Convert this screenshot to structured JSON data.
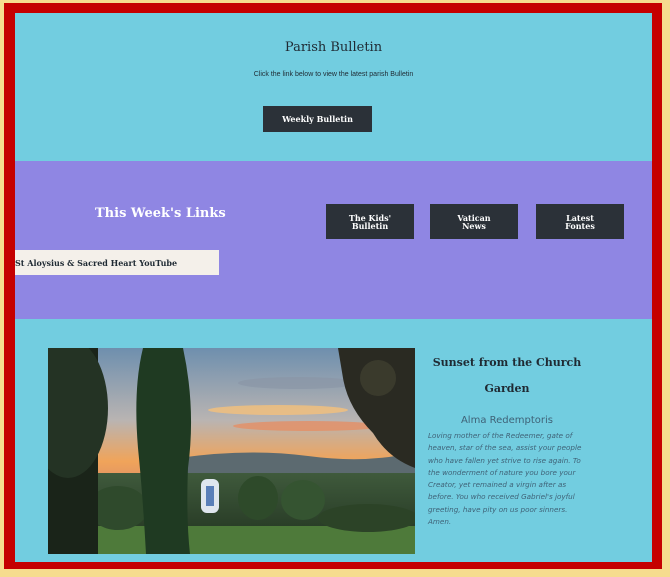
{
  "bulletin": {
    "title": "Parish Bulletin",
    "subtitle": "Click the link below to view the latest parish Bulletin",
    "button_label": "Weekly Bulletin"
  },
  "links": {
    "title": "This Week's Links",
    "kids_label": "The Kids' Bulletin",
    "vatican_label": "Vatican News",
    "fontes_label": "Latest Fontes",
    "youtube_label": "St Aloysius & Sacred Heart YouTube"
  },
  "garden": {
    "photo_title": "Sunset from the Church Garden",
    "prayer_title": "Alma Redemptoris",
    "prayer_text": "Loving mother of the Redeemer, gate of heaven, star of the sea, assist your people who have fallen yet strive to rise again. To the wonderment of nature you bore your Creator, yet remained a virgin after as before. You who received Gabriel's joyful greeting, have pity on us poor sinners. Amen."
  },
  "colors": {
    "page_background": "#f6dc8e",
    "frame_red": "#c50000",
    "section_cyan": "#72cde0",
    "section_purple": "#8f86e3",
    "button_dark": "#2b3138"
  }
}
